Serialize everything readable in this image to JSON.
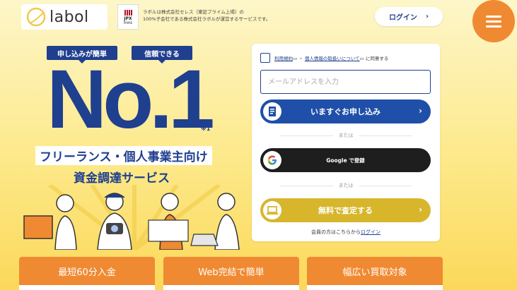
{
  "header": {
    "logo_text": "labol",
    "jpx_label": "JPX",
    "jpx_sub": "PRIME",
    "corp_note_line1": "ラボルは株式会社セレス（東証プライム上場）の",
    "corp_note_line2": "100%子会社である株式会社ラボルが運営するサービスです。",
    "login_label": "ログイン",
    "login_chevron": "›"
  },
  "hero": {
    "tag_left": "申し込みが簡単",
    "tag_right": "信頼できる",
    "main": "No.1",
    "note": "※1",
    "headline1": "フリーランス・個人事業主向け",
    "headline2": "資金調達サービス"
  },
  "form": {
    "terms_link": "利用規約",
    "separator": "・",
    "privacy_link": "個人情報の取扱いについて",
    "consent_suffix": "に同意する",
    "email_placeholder": "メールアドレスを入力",
    "apply_label": "いますぐお申し込み",
    "or1": "または",
    "google_label": "Google で登録",
    "or2": "または",
    "assess_label": "無料で査定する",
    "member_prefix": "会員の方はこちらから",
    "member_link": "ログイン",
    "chevron": "›"
  },
  "features": [
    {
      "label": "最短60分入金"
    },
    {
      "label": "Web完結で簡単"
    },
    {
      "label": "幅広い買取対象"
    }
  ],
  "colors": {
    "brand_navy": "#1f3f8f",
    "accent_orange": "#f08a32",
    "assess_gold": "#d7b62c",
    "google_dark": "#1e1e1e"
  }
}
